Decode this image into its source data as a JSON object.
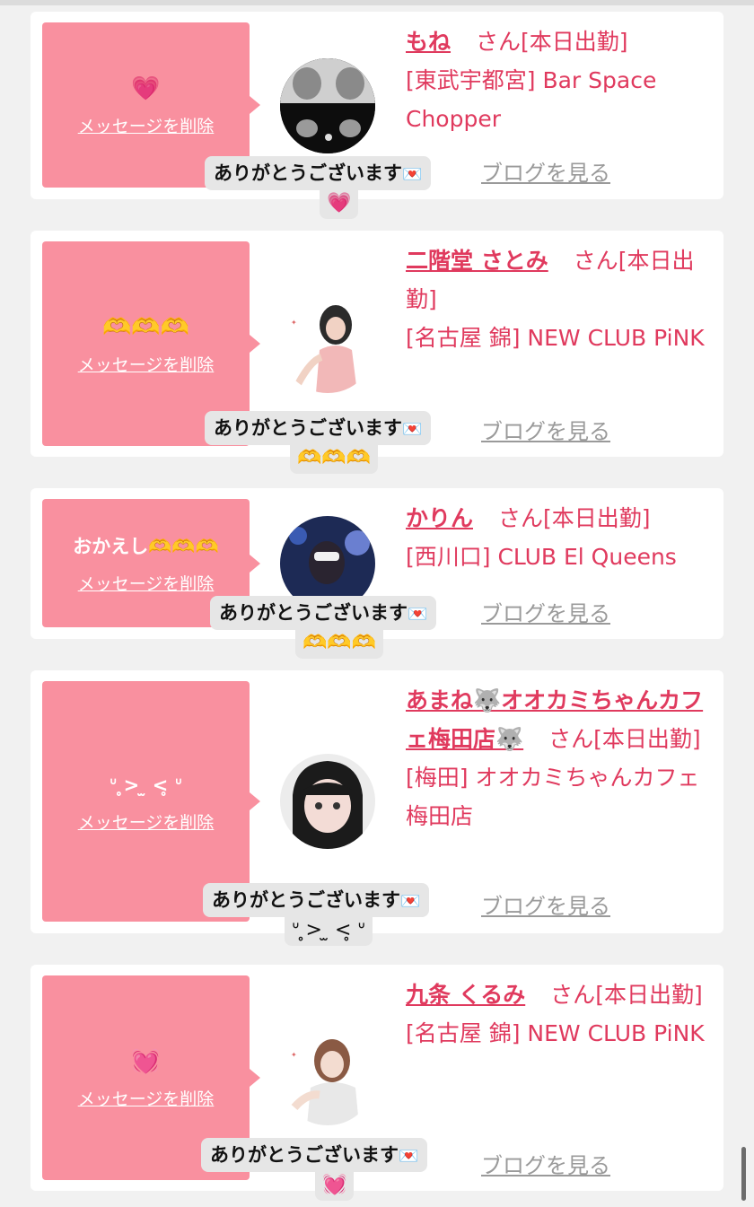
{
  "delete_label": "メッセージを削除",
  "blog_label": "ブログを見る",
  "san_suffix": "さん",
  "cards": [
    {
      "bubble": "💗",
      "name": "もね",
      "status": "[本日出勤]",
      "shop": "[東武宇都宮] Bar Space Chopper",
      "reply": "ありがとうございます",
      "reply_icon": "💌",
      "reply_sub": "💗"
    },
    {
      "bubble": "🫶🫶🫶",
      "name": "二階堂 さとみ",
      "status": "[本日出勤]",
      "shop": "[名古屋 錦] NEW CLUB PiNK",
      "reply": "ありがとうございます",
      "reply_icon": "💌",
      "reply_sub": "🫶🫶🫶"
    },
    {
      "bubble": "おかえし🫶🫶🫶",
      "name": "かりん",
      "status": "[本日出勤]",
      "shop": "[西川口] CLUB El Queens",
      "reply": "ありがとうございます",
      "reply_icon": "💌",
      "reply_sub": "🫶🫶🫶"
    },
    {
      "bubble": "ᐡ ̥> ̫ <̥ ᐡ",
      "name": "あまね🐺オオカミちゃんカフェ梅田店🐺",
      "status": "[本日出勤]",
      "shop": "[梅田] オオカミちゃんカフェ梅田店",
      "reply": "ありがとうございます",
      "reply_icon": "💌",
      "reply_sub": "ᐡ ̥> ̫ <̥ ᐡ"
    },
    {
      "bubble": "💓",
      "name": "九条 くるみ",
      "status": "[本日出勤]",
      "shop": "[名古屋 錦] NEW CLUB PiNK",
      "reply": "ありがとうございます",
      "reply_icon": "💌",
      "reply_sub": "💓"
    }
  ]
}
